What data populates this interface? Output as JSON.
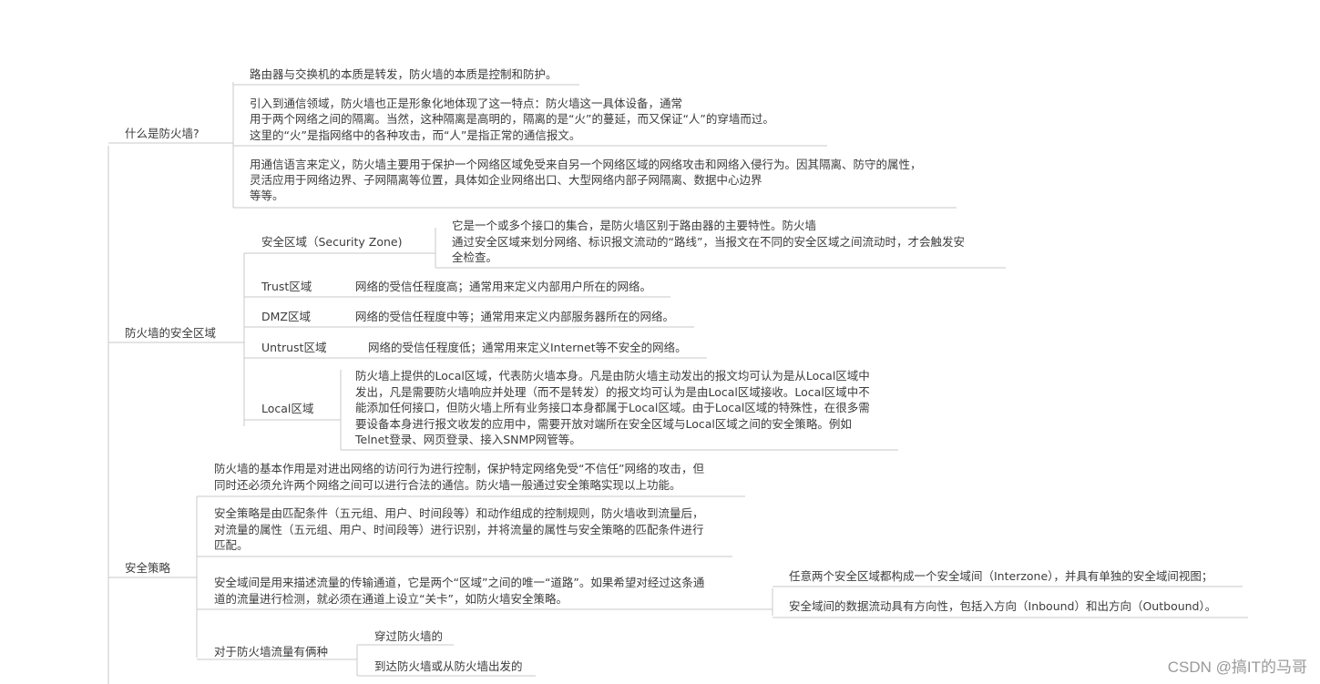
{
  "mindmap": {
    "topics": [
      {
        "label": "什么是防火墙?",
        "children": [
          [
            "路由器与交换机的本质是转发，防火墙的本质是控制和防护。"
          ],
          [
            "引入到通信领域，防火墙也正是形象化地体现了这一特点：防火墙这一具体设备，通常",
            "用于两个网络之间的隔离。当然，这种隔离是高明的，隔离的是“火”的蔓延，而又保证“人”的穿墙而过。",
            "这里的“火”是指网络中的各种攻击，而“人”是指正常的通信报文。"
          ],
          [
            "用通信语言来定义，防火墙主要用于保护一个网络区域免受来自另一个网络区域的网络攻击和网络入侵行为。因其隔离、防守的属性，",
            "灵活应用于网络边界、子网隔离等位置，具体如企业网络出口、大型网络内部子网隔离、数据中心边界",
            "等等。"
          ]
        ]
      },
      {
        "label": "防火墙的安全区域",
        "children": [
          {
            "label": "安全区域（Security Zone)",
            "desc": [
              "它是一个或多个接口的集合，是防火墙区别于路由器的主要特性。防火墙",
              "通过安全区域来划分网络、标识报文流动的“路线”，当报文在不同的安全区域之间流动时，才会触发安",
              "全检查。"
            ]
          },
          {
            "label": "Trust区域",
            "desc": [
              "网络的受信任程度高；通常用来定义内部用户所在的网络。"
            ]
          },
          {
            "label": "DMZ区域",
            "desc": [
              "网络的受信任程度中等；通常用来定义内部服务器所在的网络。"
            ]
          },
          {
            "label": "Untrust区域",
            "desc": [
              "网络的受信任程度低；通常用来定义Internet等不安全的网络。"
            ]
          },
          {
            "label": "Local区域",
            "desc": [
              "防火墙上提供的Local区域，代表防火墙本身。凡是由防火墙主动发出的报文均可认为是从Local区域中",
              "发出，凡是需要防火墙响应并处理（而不是转发）的报文均可认为是由Local区域接收。Local区域中不",
              "能添加任何接口，但防火墙上所有业务接口本身都属于Local区域。由于Local区域的特殊性，在很多需",
              "要设备本身进行报文收发的应用中，需要开放对端所在安全区域与Local区域之间的安全策略。例如",
              "Telnet登录、网页登录、接入SNMP网管等。"
            ]
          }
        ]
      },
      {
        "label": "安全策略",
        "children": [
          {
            "desc": [
              "防火墙的基本作用是对进出网络的访问行为进行控制，保护特定网络免受“不信任”网络的攻击，但",
              "同时还必须允许两个网络之间可以进行合法的通信。防火墙一般通过安全策略实现以上功能。"
            ]
          },
          {
            "desc": [
              "安全策略是由匹配条件（五元组、用户、时间段等）和动作组成的控制规则，防火墙收到流量后，",
              "对流量的属性（五元组、用户、时间段等）进行识别，并将流量的属性与安全策略的匹配条件进行",
              "匹配。"
            ]
          },
          {
            "desc": [
              "安全域间是用来描述流量的传输通道，它是两个“区域”之间的唯一“道路”。如果希望对经过这条通",
              "道的流量进行检测，就必须在通道上设立“关卡”，如防火墙安全策略。"
            ],
            "children": [
              "任意两个安全区域都构成一个安全域间（Interzone），并具有单独的安全域间视图；",
              "安全域间的数据流动具有方向性，包括入方向（Inbound）和出方向（Outbound）。"
            ]
          },
          {
            "desc": [
              "对于防火墙流量有俩种"
            ],
            "children": [
              "穿过防火墙的",
              "到达防火墙或从防火墙出发的"
            ]
          }
        ]
      }
    ]
  },
  "watermark": "CSDN @搞IT的马哥",
  "colors": {
    "line": "#c8c8c8",
    "text": "#3c3c3c",
    "watermark": "#9a9a9a"
  }
}
